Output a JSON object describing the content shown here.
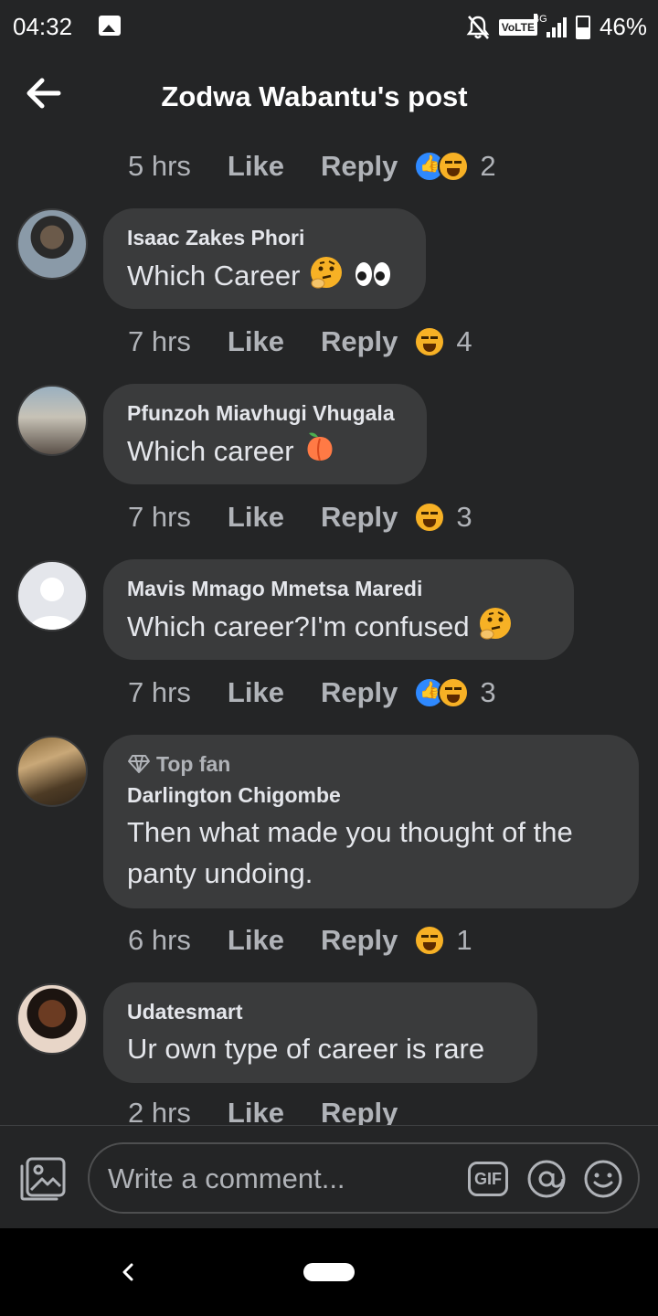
{
  "status_bar": {
    "time": "04:32",
    "network_badge": "VoLTE",
    "network_type": "4G",
    "battery": "46%",
    "icons": [
      "gallery-icon",
      "bell-off-icon",
      "signal-icon",
      "battery-icon"
    ]
  },
  "header": {
    "title": "Zodwa Wabantu's post",
    "back_icon": "arrow-left-icon"
  },
  "action_labels": {
    "like": "Like",
    "reply": "Reply"
  },
  "top_actions": {
    "time": "5 hrs",
    "reactions": [
      "like",
      "haha"
    ],
    "count": "2"
  },
  "comments": [
    {
      "name": "Isaac Zakes Phori",
      "text": "Which Career",
      "emojis": [
        "thinking-face",
        "eyes"
      ],
      "time": "7 hrs",
      "reactions": [
        "haha"
      ],
      "count": "4"
    },
    {
      "name": "Pfunzoh Miavhugi Vhugala",
      "text": "Which career",
      "emojis": [
        "peach"
      ],
      "time": "7 hrs",
      "reactions": [
        "haha"
      ],
      "count": "3"
    },
    {
      "name": "Mavis Mmago Mmetsa Maredi",
      "text": "Which career?I'm confused",
      "emojis": [
        "thinking-face"
      ],
      "time": "7 hrs",
      "reactions": [
        "like",
        "haha"
      ],
      "count": "3"
    },
    {
      "badge": "Top fan",
      "name": "Darlington Chigombe",
      "text_line1": "Then what made you thought of the",
      "text_line2": "panty undoing.",
      "time": "6 hrs",
      "reactions": [
        "haha"
      ],
      "count": "1"
    },
    {
      "name": "Udatesmart",
      "text": "Ur own type of career is rare",
      "time": "2 hrs"
    }
  ],
  "composer": {
    "placeholder": "Write a comment...",
    "gif_label": "GIF",
    "icons": [
      "photo-icon",
      "gif-icon",
      "at-mention-icon",
      "smiley-icon"
    ]
  },
  "colors": {
    "background": "#242526",
    "bubble": "#3a3b3c",
    "text_primary": "#e4e6eb",
    "text_secondary": "#b0b3b8",
    "like_blue": "#2e89ff",
    "haha_yellow": "#f7b125"
  }
}
